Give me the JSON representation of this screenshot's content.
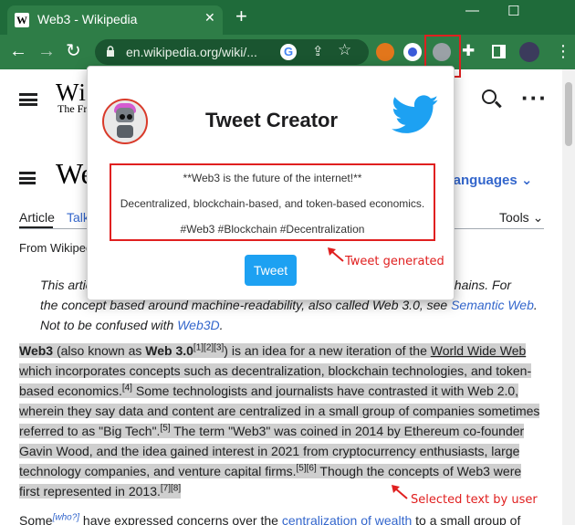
{
  "browser": {
    "tab_title": "Web3 - Wikipedia",
    "tab_close": "✕",
    "new_tab": "+",
    "win_min": "—",
    "win_max": "☐",
    "url": "en.wikipedia.org/wiki/...",
    "back": "←",
    "forward": "→",
    "reload": "↻",
    "extensions": [
      "metamask-icon",
      "circle-extension-icon",
      "robot-extension-icon",
      "puzzle-icon"
    ]
  },
  "wiki": {
    "logo": "Wiki",
    "tagline": "The Fr",
    "article_title": "Web",
    "languages": "3 languages",
    "tab_article": "Article",
    "tab_talk": "Talk",
    "tools": "Tools",
    "from": "From Wikiped",
    "hatnote": {
      "pre": "This artic",
      "pre_tail": "ckchains. For",
      "line2": "the concept based around machine-readability, also called Web 3.0, see ",
      "link1": "Semantic Web",
      "line2_end": ".",
      "line3": "Not to be confused with ",
      "link2": "Web3D",
      "line3_end": "."
    },
    "selected": {
      "t1": "Web3",
      "t2": " (also known as ",
      "t3": "Web 3.0",
      "t4": "[1][2][3]",
      "t5": ") is an idea for a new iteration of the ",
      "t6": "World Wide Web",
      "t7": " which incorporates concepts such as decentralization, blockchain technologies, and token-based economics.",
      "t8": "[4]",
      "t9": " Some technologists and journalists have contrasted it with Web 2.0, wherein they say data and content are centralized in a small group of companies sometimes referred to as \"Big Tech\".",
      "t10": "[5]",
      "t11": " The term \"Web3\" was coined in 2014 by Ethereum co-founder Gavin Wood, and the idea gained interest in 2021 from cryptocurrency enthusiasts, large technology companies, and venture capital firms.",
      "t12": "[5][6]",
      "t13": " Though the concepts of Web3 were first represented in 2013.",
      "t14": "[7][8]"
    },
    "next": {
      "t1": "Some",
      "t2": "[who?]",
      "t3": " have expressed concerns over the ",
      "t4": "centralization of wealth",
      "t5": " to a small group of"
    }
  },
  "popup": {
    "title": "Tweet Creator",
    "tweet_lines": [
      "**Web3 is the future of the internet!**",
      "Decentralized, blockchain-based, and token-based economics.",
      "#Web3 #Blockchain #Decentralization"
    ],
    "button": "Tweet"
  },
  "annotations": {
    "tweet_generated": "Tweet generated",
    "selected_text": "Selected text by user",
    "color": "#e02020"
  }
}
